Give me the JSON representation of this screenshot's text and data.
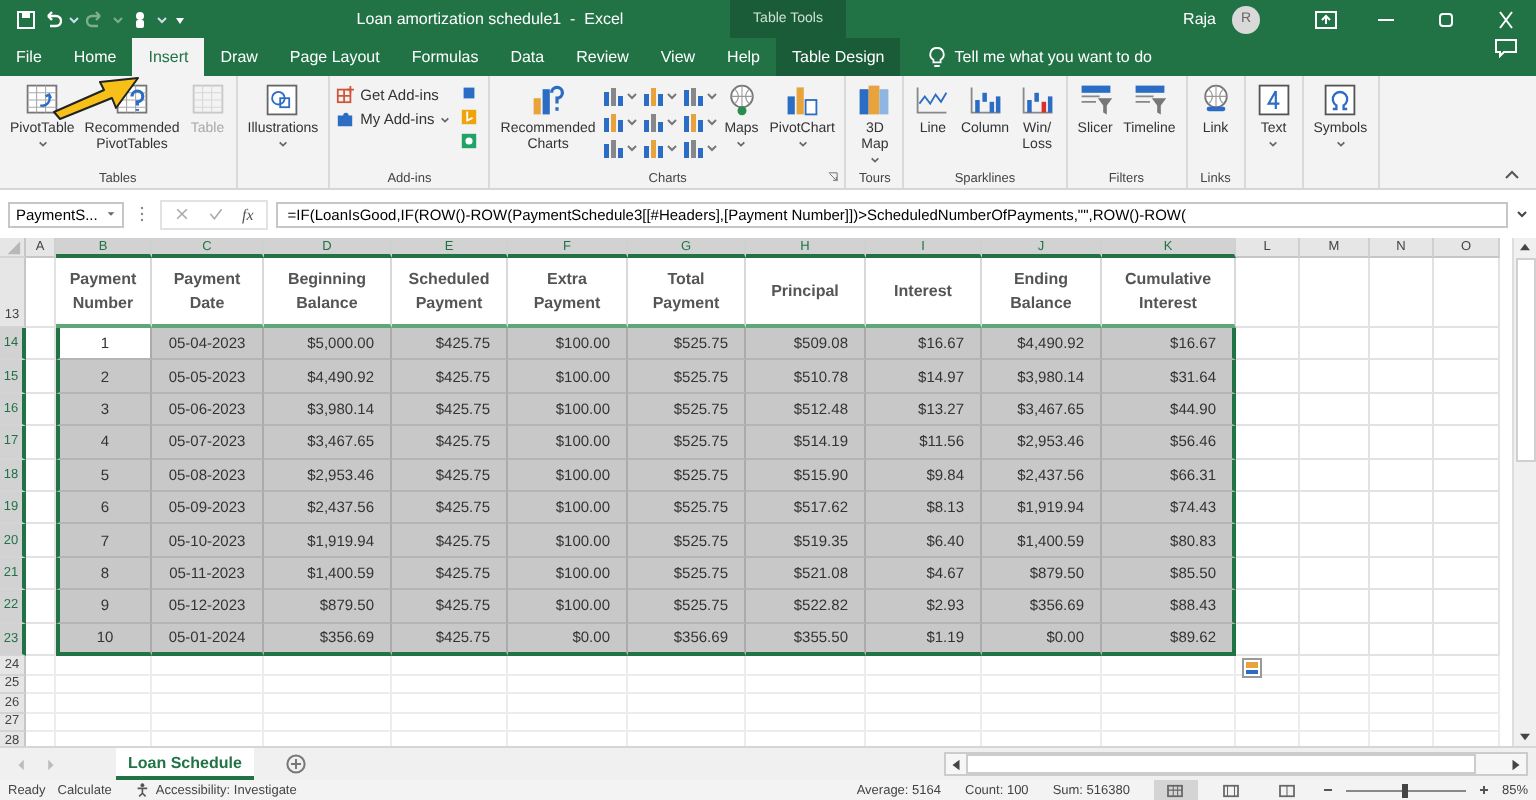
{
  "window": {
    "title": "Loan amortization schedule1  -  Excel",
    "context_label": "Table Tools",
    "user": "Raja",
    "avatar": "R"
  },
  "tabs": [
    {
      "label": "File",
      "selected": false,
      "kind": "normal"
    },
    {
      "label": "Home",
      "selected": false,
      "kind": "normal"
    },
    {
      "label": "Insert",
      "selected": true,
      "kind": "normal"
    },
    {
      "label": "Draw",
      "selected": false,
      "kind": "normal"
    },
    {
      "label": "Page Layout",
      "selected": false,
      "kind": "normal"
    },
    {
      "label": "Formulas",
      "selected": false,
      "kind": "normal"
    },
    {
      "label": "Data",
      "selected": false,
      "kind": "normal"
    },
    {
      "label": "Review",
      "selected": false,
      "kind": "normal"
    },
    {
      "label": "View",
      "selected": false,
      "kind": "normal"
    },
    {
      "label": "Help",
      "selected": false,
      "kind": "normal"
    },
    {
      "label": "Table Design",
      "selected": false,
      "kind": "contextual"
    }
  ],
  "tell_me": {
    "placeholder": "Tell me what you want to do"
  },
  "ribbon": {
    "groups": [
      {
        "label": "Tables",
        "launcher": false,
        "items": [
          {
            "kind": "large",
            "lines": [
              "PivotTable"
            ],
            "caret": true,
            "disabled": false
          },
          {
            "kind": "large",
            "lines": [
              "Recommended",
              "PivotTables"
            ],
            "caret": false,
            "disabled": false
          },
          {
            "kind": "large",
            "lines": [
              "Table"
            ],
            "caret": false,
            "disabled": true
          }
        ]
      },
      {
        "launcher": false,
        "items": [
          {
            "kind": "large",
            "lines": [
              "Illustrations"
            ],
            "caret": true,
            "disabled": false
          }
        ]
      },
      {
        "label": "Add-ins",
        "launcher": false,
        "items": [
          {
            "kind": "small-stack",
            "entries": [
              {
                "label": "Get Add-ins",
                "caret": false
              },
              {
                "label": "My Add-ins",
                "caret": true
              }
            ]
          },
          {
            "kind": "icon-column"
          }
        ]
      },
      {
        "label": "Charts",
        "launcher": true,
        "items": [
          {
            "kind": "large",
            "lines": [
              "Recommended",
              "Charts"
            ],
            "caret": false,
            "disabled": false
          },
          {
            "kind": "chart-grid"
          },
          {
            "kind": "large",
            "lines": [
              "Maps"
            ],
            "caret": true,
            "disabled": false
          },
          {
            "kind": "large",
            "lines": [
              "PivotChart"
            ],
            "caret": true,
            "disabled": false
          }
        ]
      },
      {
        "label": "Tours",
        "launcher": false,
        "items": [
          {
            "kind": "large",
            "lines": [
              "3D",
              "Map"
            ],
            "caret": true,
            "disabled": false
          }
        ]
      },
      {
        "label": "Sparklines",
        "launcher": false,
        "items": [
          {
            "kind": "large",
            "lines": [
              "Line"
            ],
            "caret": false,
            "disabled": false
          },
          {
            "kind": "large",
            "lines": [
              "Column"
            ],
            "caret": false,
            "disabled": false
          },
          {
            "kind": "large",
            "lines": [
              "Win/",
              "Loss"
            ],
            "caret": false,
            "disabled": false
          }
        ]
      },
      {
        "label": "Filters",
        "launcher": false,
        "items": [
          {
            "kind": "large",
            "lines": [
              "Slicer"
            ],
            "caret": false,
            "disabled": false
          },
          {
            "kind": "large",
            "lines": [
              "Timeline"
            ],
            "caret": false,
            "disabled": false
          }
        ]
      },
      {
        "label": "Links",
        "launcher": false,
        "items": [
          {
            "kind": "large",
            "lines": [
              "Link"
            ],
            "caret": false,
            "disabled": false
          }
        ]
      },
      {
        "launcher": false,
        "items": [
          {
            "kind": "large",
            "lines": [
              "Text"
            ],
            "caret": true,
            "disabled": false
          }
        ]
      },
      {
        "launcher": false,
        "items": [
          {
            "kind": "large",
            "lines": [
              "Symbols"
            ],
            "caret": true,
            "disabled": false
          }
        ]
      }
    ]
  },
  "formula_bar": {
    "name_box": "PaymentS...",
    "function_label": "fx",
    "formula": "=IF(LoanIsGood,IF(ROW()-ROW(PaymentSchedule3[[#Headers],[Payment Number]])>ScheduledNumberOfPayments,\"\",ROW()-ROW("
  },
  "sheet": {
    "columns": [
      {
        "label": "A",
        "selected": false
      },
      {
        "label": "B",
        "selected": true
      },
      {
        "label": "C",
        "selected": true
      },
      {
        "label": "D",
        "selected": true
      },
      {
        "label": "E",
        "selected": true
      },
      {
        "label": "F",
        "selected": true
      },
      {
        "label": "G",
        "selected": true
      },
      {
        "label": "H",
        "selected": true
      },
      {
        "label": "I",
        "selected": true
      },
      {
        "label": "J",
        "selected": true
      },
      {
        "label": "K",
        "selected": true
      },
      {
        "label": "L",
        "selected": false
      },
      {
        "label": "M",
        "selected": false
      },
      {
        "label": "N",
        "selected": false
      },
      {
        "label": "O",
        "selected": false
      }
    ],
    "rows": [
      {
        "number": "13",
        "kind": "header",
        "selected": false,
        "headers": [
          [
            "Payment",
            "Number"
          ],
          [
            "Payment",
            "Date"
          ],
          [
            "Beginning",
            "Balance"
          ],
          [
            "Scheduled",
            "Payment"
          ],
          [
            "Extra",
            "Payment"
          ],
          [
            "Total",
            "Payment"
          ],
          [
            "Principal"
          ],
          [
            "Interest"
          ],
          [
            "Ending",
            "Balance"
          ],
          [
            "Cumulative",
            "Interest"
          ]
        ]
      },
      {
        "number": "14",
        "kind": "data",
        "selected": true,
        "active": true,
        "cells": [
          "1",
          "05-04-2023",
          "$5,000.00",
          "$425.75",
          "$100.00",
          "$525.75",
          "$509.08",
          "$16.67",
          "$4,490.92",
          "$16.67"
        ]
      },
      {
        "number": "15",
        "kind": "data",
        "selected": true,
        "active": false,
        "cells": [
          "2",
          "05-05-2023",
          "$4,490.92",
          "$425.75",
          "$100.00",
          "$525.75",
          "$510.78",
          "$14.97",
          "$3,980.14",
          "$31.64"
        ]
      },
      {
        "number": "16",
        "kind": "data",
        "selected": true,
        "active": false,
        "cells": [
          "3",
          "05-06-2023",
          "$3,980.14",
          "$425.75",
          "$100.00",
          "$525.75",
          "$512.48",
          "$13.27",
          "$3,467.65",
          "$44.90"
        ]
      },
      {
        "number": "17",
        "kind": "data",
        "selected": true,
        "active": false,
        "cells": [
          "4",
          "05-07-2023",
          "$3,467.65",
          "$425.75",
          "$100.00",
          "$525.75",
          "$514.19",
          "$11.56",
          "$2,953.46",
          "$56.46"
        ]
      },
      {
        "number": "18",
        "kind": "data",
        "selected": true,
        "active": false,
        "cells": [
          "5",
          "05-08-2023",
          "$2,953.46",
          "$425.75",
          "$100.00",
          "$525.75",
          "$515.90",
          "$9.84",
          "$2,437.56",
          "$66.31"
        ]
      },
      {
        "number": "19",
        "kind": "data",
        "selected": true,
        "active": false,
        "cells": [
          "6",
          "05-09-2023",
          "$2,437.56",
          "$425.75",
          "$100.00",
          "$525.75",
          "$517.62",
          "$8.13",
          "$1,919.94",
          "$74.43"
        ]
      },
      {
        "number": "20",
        "kind": "data",
        "selected": true,
        "active": false,
        "cells": [
          "7",
          "05-10-2023",
          "$1,919.94",
          "$425.75",
          "$100.00",
          "$525.75",
          "$519.35",
          "$6.40",
          "$1,400.59",
          "$80.83"
        ]
      },
      {
        "number": "21",
        "kind": "data",
        "selected": true,
        "active": false,
        "cells": [
          "8",
          "05-11-2023",
          "$1,400.59",
          "$425.75",
          "$100.00",
          "$525.75",
          "$521.08",
          "$4.67",
          "$879.50",
          "$85.50"
        ]
      },
      {
        "number": "22",
        "kind": "data",
        "selected": true,
        "active": false,
        "cells": [
          "9",
          "05-12-2023",
          "$879.50",
          "$425.75",
          "$100.00",
          "$525.75",
          "$522.82",
          "$2.93",
          "$356.69",
          "$88.43"
        ]
      },
      {
        "number": "23",
        "kind": "data",
        "selected": true,
        "active": false,
        "cells": [
          "10",
          "05-01-2024",
          "$356.69",
          "$425.75",
          "$0.00",
          "$356.69",
          "$355.50",
          "$1.19",
          "$0.00",
          "$89.62"
        ]
      },
      {
        "number": "24",
        "kind": "empty",
        "selected": false
      },
      {
        "number": "25",
        "kind": "empty",
        "selected": false
      },
      {
        "number": "26",
        "kind": "empty",
        "selected": false
      },
      {
        "number": "27",
        "kind": "empty",
        "selected": false
      },
      {
        "number": "28",
        "kind": "empty",
        "selected": false
      }
    ]
  },
  "sheet_tabs": [
    {
      "label": "Loan Schedule",
      "selected": true
    }
  ],
  "status_bar": {
    "mode": "Ready",
    "calculate": "Calculate",
    "accessibility": "Accessibility: Investigate",
    "stats": [
      "Average: 5164",
      "Count: 100",
      "Sum: 516380"
    ],
    "views": [
      {
        "selected": true
      },
      {
        "selected": false
      },
      {
        "selected": false
      }
    ],
    "zoom": {
      "level": 0.5,
      "reading": "85%"
    }
  }
}
